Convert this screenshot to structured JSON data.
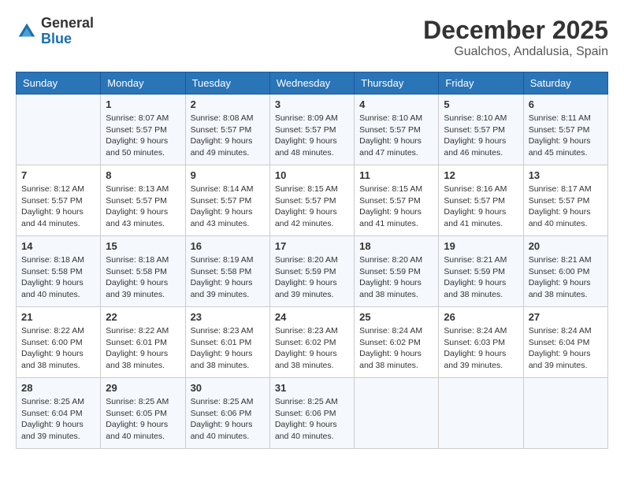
{
  "logo": {
    "general": "General",
    "blue": "Blue"
  },
  "title": "December 2025",
  "location": "Gualchos, Andalusia, Spain",
  "days_of_week": [
    "Sunday",
    "Monday",
    "Tuesday",
    "Wednesday",
    "Thursday",
    "Friday",
    "Saturday"
  ],
  "weeks": [
    [
      {
        "day": "",
        "info": ""
      },
      {
        "day": "1",
        "info": "Sunrise: 8:07 AM\nSunset: 5:57 PM\nDaylight: 9 hours\nand 50 minutes."
      },
      {
        "day": "2",
        "info": "Sunrise: 8:08 AM\nSunset: 5:57 PM\nDaylight: 9 hours\nand 49 minutes."
      },
      {
        "day": "3",
        "info": "Sunrise: 8:09 AM\nSunset: 5:57 PM\nDaylight: 9 hours\nand 48 minutes."
      },
      {
        "day": "4",
        "info": "Sunrise: 8:10 AM\nSunset: 5:57 PM\nDaylight: 9 hours\nand 47 minutes."
      },
      {
        "day": "5",
        "info": "Sunrise: 8:10 AM\nSunset: 5:57 PM\nDaylight: 9 hours\nand 46 minutes."
      },
      {
        "day": "6",
        "info": "Sunrise: 8:11 AM\nSunset: 5:57 PM\nDaylight: 9 hours\nand 45 minutes."
      }
    ],
    [
      {
        "day": "7",
        "info": "Sunrise: 8:12 AM\nSunset: 5:57 PM\nDaylight: 9 hours\nand 44 minutes."
      },
      {
        "day": "8",
        "info": "Sunrise: 8:13 AM\nSunset: 5:57 PM\nDaylight: 9 hours\nand 43 minutes."
      },
      {
        "day": "9",
        "info": "Sunrise: 8:14 AM\nSunset: 5:57 PM\nDaylight: 9 hours\nand 43 minutes."
      },
      {
        "day": "10",
        "info": "Sunrise: 8:15 AM\nSunset: 5:57 PM\nDaylight: 9 hours\nand 42 minutes."
      },
      {
        "day": "11",
        "info": "Sunrise: 8:15 AM\nSunset: 5:57 PM\nDaylight: 9 hours\nand 41 minutes."
      },
      {
        "day": "12",
        "info": "Sunrise: 8:16 AM\nSunset: 5:57 PM\nDaylight: 9 hours\nand 41 minutes."
      },
      {
        "day": "13",
        "info": "Sunrise: 8:17 AM\nSunset: 5:57 PM\nDaylight: 9 hours\nand 40 minutes."
      }
    ],
    [
      {
        "day": "14",
        "info": "Sunrise: 8:18 AM\nSunset: 5:58 PM\nDaylight: 9 hours\nand 40 minutes."
      },
      {
        "day": "15",
        "info": "Sunrise: 8:18 AM\nSunset: 5:58 PM\nDaylight: 9 hours\nand 39 minutes."
      },
      {
        "day": "16",
        "info": "Sunrise: 8:19 AM\nSunset: 5:58 PM\nDaylight: 9 hours\nand 39 minutes."
      },
      {
        "day": "17",
        "info": "Sunrise: 8:20 AM\nSunset: 5:59 PM\nDaylight: 9 hours\nand 39 minutes."
      },
      {
        "day": "18",
        "info": "Sunrise: 8:20 AM\nSunset: 5:59 PM\nDaylight: 9 hours\nand 38 minutes."
      },
      {
        "day": "19",
        "info": "Sunrise: 8:21 AM\nSunset: 5:59 PM\nDaylight: 9 hours\nand 38 minutes."
      },
      {
        "day": "20",
        "info": "Sunrise: 8:21 AM\nSunset: 6:00 PM\nDaylight: 9 hours\nand 38 minutes."
      }
    ],
    [
      {
        "day": "21",
        "info": "Sunrise: 8:22 AM\nSunset: 6:00 PM\nDaylight: 9 hours\nand 38 minutes."
      },
      {
        "day": "22",
        "info": "Sunrise: 8:22 AM\nSunset: 6:01 PM\nDaylight: 9 hours\nand 38 minutes."
      },
      {
        "day": "23",
        "info": "Sunrise: 8:23 AM\nSunset: 6:01 PM\nDaylight: 9 hours\nand 38 minutes."
      },
      {
        "day": "24",
        "info": "Sunrise: 8:23 AM\nSunset: 6:02 PM\nDaylight: 9 hours\nand 38 minutes."
      },
      {
        "day": "25",
        "info": "Sunrise: 8:24 AM\nSunset: 6:02 PM\nDaylight: 9 hours\nand 38 minutes."
      },
      {
        "day": "26",
        "info": "Sunrise: 8:24 AM\nSunset: 6:03 PM\nDaylight: 9 hours\nand 39 minutes."
      },
      {
        "day": "27",
        "info": "Sunrise: 8:24 AM\nSunset: 6:04 PM\nDaylight: 9 hours\nand 39 minutes."
      }
    ],
    [
      {
        "day": "28",
        "info": "Sunrise: 8:25 AM\nSunset: 6:04 PM\nDaylight: 9 hours\nand 39 minutes."
      },
      {
        "day": "29",
        "info": "Sunrise: 8:25 AM\nSunset: 6:05 PM\nDaylight: 9 hours\nand 40 minutes."
      },
      {
        "day": "30",
        "info": "Sunrise: 8:25 AM\nSunset: 6:06 PM\nDaylight: 9 hours\nand 40 minutes."
      },
      {
        "day": "31",
        "info": "Sunrise: 8:25 AM\nSunset: 6:06 PM\nDaylight: 9 hours\nand 40 minutes."
      },
      {
        "day": "",
        "info": ""
      },
      {
        "day": "",
        "info": ""
      },
      {
        "day": "",
        "info": ""
      }
    ]
  ]
}
